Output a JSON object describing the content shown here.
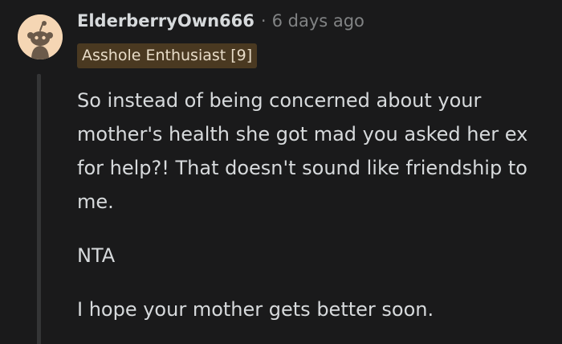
{
  "comment": {
    "author": "ElderberryOwn666",
    "separator": "·",
    "timestamp": "6 days ago",
    "flair": "Asshole Enthusiast [9]",
    "paragraphs": [
      "So instead of being concerned about your mother's health she got mad you asked her ex for help?! That doesn't sound like friendship to me.",
      "NTA",
      "I hope your mother gets better soon."
    ]
  },
  "colors": {
    "background": "#1a1a1b",
    "text": "#d7dadc",
    "muted": "#818384",
    "flair_bg": "#4a3921",
    "avatar_bg": "#f5d6b4"
  },
  "icons": {
    "avatar": "snoo-avatar-icon"
  }
}
